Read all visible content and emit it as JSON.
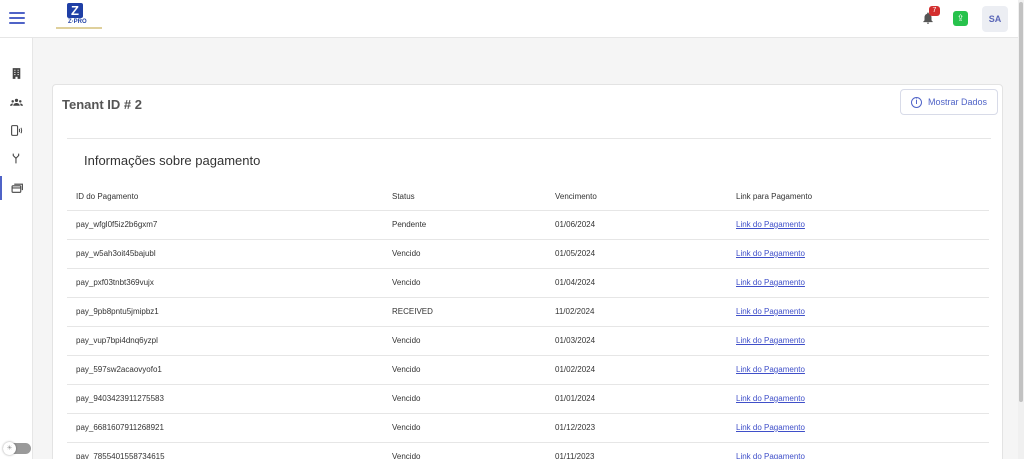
{
  "header": {
    "logo_text": "Z·PRO",
    "notification_count": "7",
    "avatar_initials": "SA"
  },
  "sidebar": {
    "items": [
      {
        "icon": "building-icon"
      },
      {
        "icon": "users-icon"
      },
      {
        "icon": "phone-wave-icon"
      },
      {
        "icon": "fork-icon"
      },
      {
        "icon": "cards-icon"
      }
    ]
  },
  "card": {
    "title": "Tenant ID # 2",
    "show_button_label": "Mostrar Dados",
    "section_title": "Informações sobre pagamento"
  },
  "table": {
    "headers": [
      "ID do Pagamento",
      "Status",
      "Vencimento",
      "Link para Pagamento"
    ],
    "rows": [
      {
        "id": "pay_wfgl0f5iz2b6gxm7",
        "status": "Pendente",
        "due": "01/06/2024",
        "link": "Link do Pagamento"
      },
      {
        "id": "pay_w5ah3oit45bajubl",
        "status": "Vencido",
        "due": "01/05/2024",
        "link": "Link do Pagamento"
      },
      {
        "id": "pay_pxf03tnbt369vujx",
        "status": "Vencido",
        "due": "01/04/2024",
        "link": "Link do Pagamento"
      },
      {
        "id": "pay_9pb8pntu5jmipbz1",
        "status": "RECEIVED",
        "due": "11/02/2024",
        "link": "Link do Pagamento"
      },
      {
        "id": "pay_vup7bpi4dnq6yzpl",
        "status": "Vencido",
        "due": "01/03/2024",
        "link": "Link do Pagamento"
      },
      {
        "id": "pay_597sw2acaovyofo1",
        "status": "Vencido",
        "due": "01/02/2024",
        "link": "Link do Pagamento"
      },
      {
        "id": "pay_9403423911275583",
        "status": "Vencido",
        "due": "01/01/2024",
        "link": "Link do Pagamento"
      },
      {
        "id": "pay_6681607911268921",
        "status": "Vencido",
        "due": "01/12/2023",
        "link": "Link do Pagamento"
      },
      {
        "id": "pay_7855401558734615",
        "status": "Vencido",
        "due": "01/11/2023",
        "link": "Link do Pagamento"
      }
    ]
  },
  "colors": {
    "accent": "#4f63c7",
    "link": "#3f4fc9",
    "badge": "#d32f2f",
    "upload": "#27c24c"
  }
}
